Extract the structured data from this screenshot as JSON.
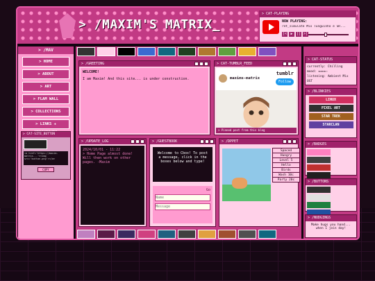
{
  "site": {
    "title": "> /MAXIM'S MATRIX_"
  },
  "now_playing": {
    "window_title": "> CAT-PLAYING",
    "label": "NOW PLAYING:",
    "song": "ret_simulate Mix",
    "artist": "Tunguinho e SR...",
    "buttons": [
      "|<",
      "▶",
      "||",
      ">|"
    ]
  },
  "sidebar": {
    "title": "> /MAV",
    "items": [
      {
        "label": "> HOME"
      },
      {
        "label": "> ABOUT"
      },
      {
        "label": "> ART"
      },
      {
        "label": "> FLAM WALL"
      },
      {
        "label": "> COLLECTIONS"
      },
      {
        "label": "> LINKS + NEIGHBOURS"
      }
    ],
    "site_button": {
      "title": "> CAT-SITE_BUTTON",
      "code": "<a href='https://maxim-matrix...'><img src='button.png'></a>",
      "copy_label": "COPY"
    }
  },
  "panels": {
    "greeting": {
      "title": "> /GREETING",
      "heading": "WELCOME!",
      "text": "I am Maxim! And this site... is under construction."
    },
    "tumblr": {
      "title": "> CAT-TUMBLR_FEED",
      "name": "maxims-matrix",
      "logo": "tumblr",
      "follow": "Follow",
      "caption": "> Pinned post from this blog"
    },
    "log": {
      "title": "> /UPDATE_LOG",
      "date": "2024/10/01 - 11:22",
      "text": "> Home Page almost done! Will then work on other pages. -Maxim"
    },
    "guestbook": {
      "title": "> /GUESTBOOK",
      "message": "Welcome to Cbox! To post a message, click in the boxes below and type!",
      "name_placeholder": "Name",
      "msg_placeholder": "Message",
      "go": "Go"
    },
    "pet": {
      "title": "> /DPPET",
      "tabs": [
        "Spaced",
        "Hungry",
        "Level 5"
      ],
      "rows": [
        "Hello",
        "Birds",
        "Wash 10c",
        "Party 20c"
      ]
    }
  },
  "right": {
    "status": {
      "title": "> CAT-STATUS",
      "mood_label": "currently:",
      "mood": "Chilling",
      "rating_label": "mood:",
      "rating": "★★★★☆",
      "listening_label": "listening:",
      "listening": "Ambient Mix OST"
    },
    "fandoms": {
      "title": "> /BLINKIES",
      "items": [
        "LINUX",
        "PIXEL ART",
        "STAR TREK",
        "STARCLAN"
      ]
    },
    "badges": {
      "title": "> /BADGES"
    },
    "buttons": {
      "title": "> /BUTTONS"
    },
    "guides": {
      "title": "> /NUDGINGS",
      "text": "Make hugs you hand... when I join day!"
    }
  },
  "colors": {
    "accent": "#c23a84",
    "light": "#ff9bd0",
    "dark": "#60103c"
  }
}
